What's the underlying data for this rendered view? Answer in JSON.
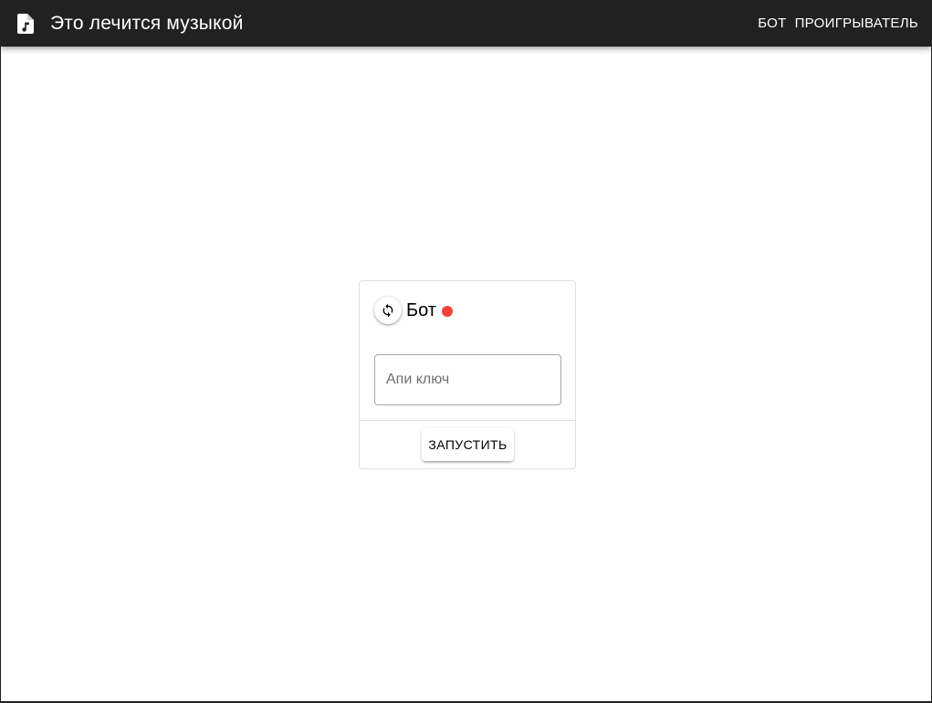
{
  "app_bar": {
    "title": "Это лечится музыкой",
    "icon": "music-file-icon",
    "background": "#212121",
    "nav": [
      {
        "label": "БОТ"
      },
      {
        "label": "ПРОИГРЫВАТЕЛЬ"
      }
    ]
  },
  "card": {
    "title": "Бот",
    "refresh_icon": "refresh-icon",
    "status": {
      "state": "offline",
      "color": "#f44336"
    },
    "api_input": {
      "placeholder": "Апи ключ",
      "value": ""
    },
    "start_label": "ЗАПУСТИТЬ"
  }
}
